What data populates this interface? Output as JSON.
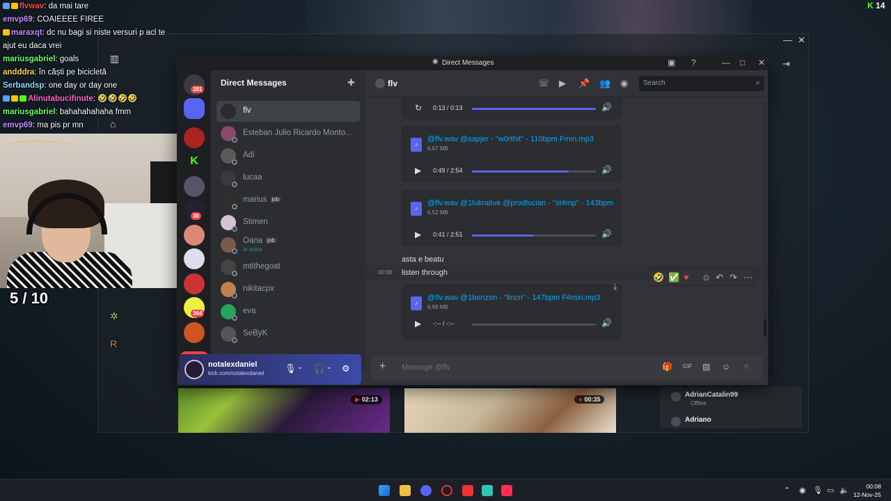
{
  "stream": {
    "chat": [
      {
        "user": "flvwav",
        "color": "#ff4d4d",
        "text": "da mai tare"
      },
      {
        "user": "emvp69",
        "color": "#c58cff",
        "text": "COAIEEEE FIREE"
      },
      {
        "user": "maraxqt",
        "color": "#c58cff",
        "text": "dc nu bagi si niste versuri p acl te ajut eu daca vrei"
      },
      {
        "user": "mariusgabriel",
        "color": "#6cff6c",
        "text": "goals"
      },
      {
        "user": "andddra",
        "color": "#ffd34d",
        "text": "în căști pe bicicletă"
      },
      {
        "user": "Serbandsp",
        "color": "#8fd7ff",
        "text": "one day or day one"
      },
      {
        "user": "Alinutabucifinute",
        "color": "#ff66cc",
        "text": "🤣🤣🤣🤣"
      },
      {
        "user": "mariusgabriel",
        "color": "#6cff6c",
        "text": "bahahahahaha fmm"
      },
      {
        "user": "emvp69",
        "color": "#c58cff",
        "text": "ma pis pr mn"
      }
    ],
    "counter": "5 / 10",
    "viewer_count": "14"
  },
  "discord": {
    "window_title": "Direct Messages",
    "dm_header": "Direct Messages",
    "dms": [
      {
        "name": "flv",
        "active": true,
        "color": "#2b2b2b"
      },
      {
        "name": "Esteban Julio Ricardo Monto...",
        "color": "#8a4a6a"
      },
      {
        "name": "Adi",
        "color": "#5a5a5a"
      },
      {
        "name": "lucaa",
        "color": "#3a3a3a"
      },
      {
        "name": "marius",
        "tag": "job",
        "color": "#2f2f2f"
      },
      {
        "name": "Stimen",
        "color": "#d9c2d0"
      },
      {
        "name": "Oana",
        "tag": "job",
        "sub": "In voice",
        "color": "#7a5a4a"
      },
      {
        "name": "mtithegoat",
        "color": "#444"
      },
      {
        "name": "nikitacpx",
        "color": "#c08050"
      },
      {
        "name": "eva",
        "color": "#23a55a"
      },
      {
        "name": "SeByK",
        "color": "#555"
      }
    ],
    "guild_badges": {
      "home": "281",
      "g5": "30",
      "g9": "364",
      "new": "NEW"
    },
    "user": {
      "name": "notalexdaniel",
      "sub": "kick.com/notalexdaniel"
    },
    "channel": {
      "name": "flv",
      "search_placeholder": "Search"
    },
    "attachments": [
      {
        "time": "0:13 / 0:13",
        "progress": 1.0
      },
      {
        "file": "@flv.wav @sapjer - \"w0rthit\" - 110bpm Fmin.mp3",
        "size": "6.67 MB",
        "time": "0:49 / 2:54",
        "progress": 0.78
      },
      {
        "file": "@flv.wav @1lukrative @prodlucian - \"st4mp\" - 143bpm",
        "size": "6.52 MB",
        "time": "0:41 / 2:51",
        "progress": 0.5
      },
      {
        "file": "@flv.wav @1benzon - \"lincn\" - 147bpm F#min.mp3",
        "size": "6.99 MB",
        "time": "-:-- / -:--",
        "progress": 0.0
      }
    ],
    "messages": [
      {
        "text": "asta e beatu"
      },
      {
        "time": "00:08",
        "text": "listen through"
      }
    ],
    "composer_placeholder": "Message @flv"
  },
  "background": {
    "thumb1_duration": "02:13",
    "thumb2_duration": "00:35",
    "friends": [
      {
        "name": "AdrianCatalin99",
        "status": "Offline"
      },
      {
        "name": "Adriano",
        "status": ""
      }
    ]
  },
  "taskbar": {
    "time": "00:08",
    "date": "12-Nov-25"
  },
  "colors": {
    "blurple": "#5865f2",
    "link": "#00a8fc",
    "red": "#f23f43",
    "green": "#23a55a",
    "kick": "#53fc18"
  }
}
